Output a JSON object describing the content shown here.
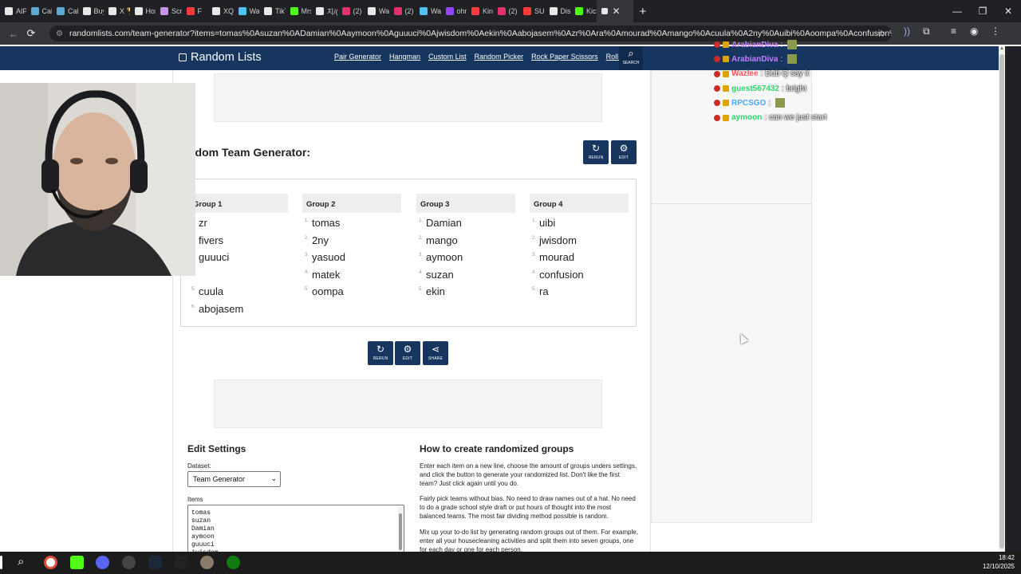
{
  "browser": {
    "tabs": [
      {
        "label": "AIPA",
        "icon": "x-icon",
        "color": "#e8e8e8"
      },
      {
        "label": "Call",
        "icon": "steam-icon",
        "color": "#5fa8d3"
      },
      {
        "label": "Call",
        "icon": "steam-icon",
        "color": "#5fa8d3"
      },
      {
        "label": "Buy",
        "icon": "github-icon",
        "color": "#e8e8e8"
      },
      {
        "label": "X 🏆",
        "icon": "x-icon",
        "color": "#e8e8e8"
      },
      {
        "label": "Hon",
        "icon": "x-icon",
        "color": "#e8e8e8"
      },
      {
        "label": "Scre",
        "icon": "pen-icon",
        "color": "#c792ea"
      },
      {
        "label": "F",
        "icon": "youtube-icon",
        "color": "#ff3b3b"
      },
      {
        "label": "XQ",
        "icon": "x-icon",
        "color": "#e8e8e8"
      },
      {
        "label": "Wa",
        "icon": "twitch-icon",
        "color": "#4fc3f7"
      },
      {
        "label": "TikT",
        "icon": "tiktok-icon",
        "color": "#e8e8e8"
      },
      {
        "label": "Mrs",
        "icon": "kick-icon",
        "color": "#53fc18"
      },
      {
        "label": "지/(",
        "icon": "tiktok-icon",
        "color": "#e8e8e8"
      },
      {
        "label": "(2)",
        "icon": "instagram-icon",
        "color": "#e1306c"
      },
      {
        "label": "Wa",
        "icon": "tiktok-icon",
        "color": "#e8e8e8"
      },
      {
        "label": "(2)",
        "icon": "instagram-icon",
        "color": "#e1306c"
      },
      {
        "label": "Wa",
        "icon": "twitch-icon",
        "color": "#4fc3f7"
      },
      {
        "label": "ohn",
        "icon": "twitch-icon",
        "color": "#9146ff"
      },
      {
        "label": "King",
        "icon": "youtube-icon",
        "color": "#ff3b3b"
      },
      {
        "label": "(2)",
        "icon": "instagram-icon",
        "color": "#e1306c"
      },
      {
        "label": "SUG",
        "icon": "youtube-icon",
        "color": "#ff3b3b"
      },
      {
        "label": "Disc",
        "icon": "globe-icon",
        "color": "#e8e8e8"
      },
      {
        "label": "Kick",
        "icon": "kick-icon",
        "color": "#53fc18"
      }
    ],
    "url": "randomlists.com/team-generator?items=tomas%0Asuzan%0ADamian%0Aaymoon%0Aguuuci%0Ajwisdom%0Aekin%0Aabojasem%0Azr%0Ara%0Amourad%0Amango%0Acuula%0A2ny%0Auibi%0Aoompa%0Aconfusion%0Amatek%0Afivers%0..."
  },
  "site": {
    "logo": "Random Lists",
    "nav": [
      "Pair Generator",
      "Hangman",
      "Custom List",
      "Random Picker",
      "Rock Paper Scissors",
      "Roll Dice"
    ],
    "search_label": "SEARCH",
    "title": "ndom Team Generator:",
    "rerun_label": "RERUN",
    "edit_label": "EDIT",
    "share_label": "SHARE",
    "groups": [
      {
        "name": "Group 1",
        "items": [
          {
            "n": "",
            "v": "zr"
          },
          {
            "n": "",
            "v": "fivers"
          },
          {
            "n": "",
            "v": "guuuci"
          },
          {
            "n": "",
            "v": ""
          },
          {
            "n": "5.",
            "v": "cuula"
          },
          {
            "n": "6.",
            "v": "abojasem"
          }
        ]
      },
      {
        "name": "Group 2",
        "items": [
          {
            "n": "1.",
            "v": "tomas"
          },
          {
            "n": "2.",
            "v": "2ny"
          },
          {
            "n": "3.",
            "v": "yasuod"
          },
          {
            "n": "4.",
            "v": "matek"
          },
          {
            "n": "5.",
            "v": "oompa"
          }
        ]
      },
      {
        "name": "Group 3",
        "items": [
          {
            "n": "1.",
            "v": "Damian"
          },
          {
            "n": "2.",
            "v": "mango"
          },
          {
            "n": "3.",
            "v": "aymoon"
          },
          {
            "n": "4.",
            "v": "suzan"
          },
          {
            "n": "5.",
            "v": "ekin"
          }
        ]
      },
      {
        "name": "Group 4",
        "items": [
          {
            "n": "1.",
            "v": "uibi"
          },
          {
            "n": "2.",
            "v": "jwisdom"
          },
          {
            "n": "3.",
            "v": "mourad"
          },
          {
            "n": "4.",
            "v": "confusion"
          },
          {
            "n": "5.",
            "v": "ra"
          }
        ]
      }
    ],
    "settings": {
      "heading": "Edit Settings",
      "dataset_label": "Dataset:",
      "dataset_value": "Team Generator",
      "items_label": "Items",
      "items_lines": [
        "tomas",
        "suzan",
        "Damian",
        "aymoon",
        "guuuci",
        "jwisdom"
      ]
    },
    "howto": {
      "heading": "How to create randomized groups",
      "p1": "Enter each item on a new line, choose the amount of groups unders settings, and click the button to generate your randomized list. Don't like the first team? Just click again until you do.",
      "p2": "Fairly pick teams without bias. No need to draw names out of a hat. No need to do a grade school style draft or put hours of thought into the most balanced teams. The most fair dividing method possible is random.",
      "p3": "Mix up your to-do list by generating random groups out of them. For example, enter all your housecleaning activities and split them into seven groups, one for each day or one for each person."
    }
  },
  "chat": [
    {
      "user": "ArabianDiva",
      "color": "#c57dff",
      "msg": "",
      "emote": true
    },
    {
      "user": "ArabianDiva",
      "color": "#c57dff",
      "msg": "",
      "emote": true
    },
    {
      "user": "Wazlee",
      "color": "#ff5555",
      "msg": "Dub Q say it",
      "emote": false
    },
    {
      "user": "guest567432",
      "color": "#2fd36b",
      "msg": "bright",
      "emote": false
    },
    {
      "user": "RPCSGO",
      "color": "#4aa8ff",
      "msg": "",
      "emote": true
    },
    {
      "user": "aymoon",
      "color": "#2fd36b",
      "msg": "can we just start",
      "emote": false
    }
  ],
  "taskbar": {
    "time": "18:42",
    "date": "12/10/2025"
  }
}
